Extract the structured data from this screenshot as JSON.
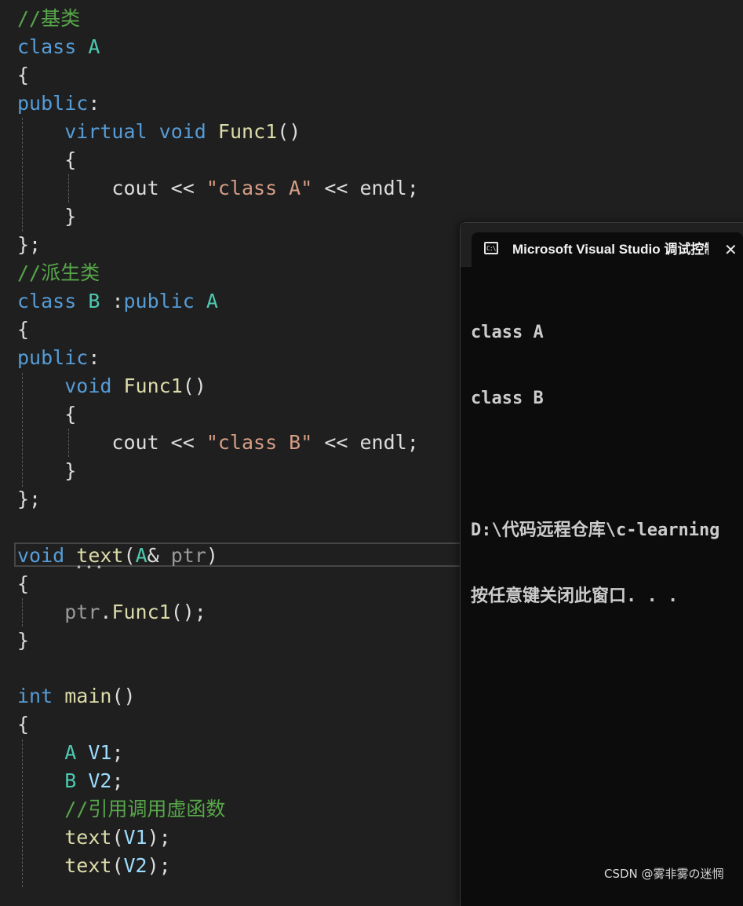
{
  "colors": {
    "background": "#1f1f1f",
    "comment": "#57a64a",
    "keyword": "#569cd6",
    "type": "#4ec9b0",
    "function": "#dcdcaa",
    "string": "#d69d85",
    "variable": "#9cdcfe",
    "param": "#9a9a9a",
    "text": "#dcdcdc",
    "console_bg": "#0c0c0c",
    "console_text": "#cccccc"
  },
  "editor": {
    "lines": [
      [
        [
          "comment",
          "//基类"
        ]
      ],
      [
        [
          "keyword",
          "class"
        ],
        [
          "text",
          " "
        ],
        [
          "type",
          "A"
        ]
      ],
      [
        [
          "text",
          "{"
        ]
      ],
      [
        [
          "keyword",
          "public"
        ],
        [
          "text",
          ":"
        ]
      ],
      [
        [
          "text",
          "    "
        ],
        [
          "keyword",
          "virtual"
        ],
        [
          "text",
          " "
        ],
        [
          "keyword",
          "void"
        ],
        [
          "text",
          " "
        ],
        [
          "function",
          "Func1"
        ],
        [
          "text",
          "()"
        ]
      ],
      [
        [
          "text",
          "    {"
        ]
      ],
      [
        [
          "text",
          "        cout << "
        ],
        [
          "string",
          "\"class A\""
        ],
        [
          "text",
          " << endl;"
        ]
      ],
      [
        [
          "text",
          "    }"
        ]
      ],
      [
        [
          "text",
          "};"
        ]
      ],
      [
        [
          "comment",
          "//派生类"
        ]
      ],
      [
        [
          "keyword",
          "class"
        ],
        [
          "text",
          " "
        ],
        [
          "type",
          "B"
        ],
        [
          "text",
          " :"
        ],
        [
          "keyword",
          "public"
        ],
        [
          "text",
          " "
        ],
        [
          "type",
          "A"
        ]
      ],
      [
        [
          "text",
          "{"
        ]
      ],
      [
        [
          "keyword",
          "public"
        ],
        [
          "text",
          ":"
        ]
      ],
      [
        [
          "text",
          "    "
        ],
        [
          "keyword",
          "void"
        ],
        [
          "text",
          " "
        ],
        [
          "function",
          "Func1"
        ],
        [
          "text",
          "()"
        ]
      ],
      [
        [
          "text",
          "    {"
        ]
      ],
      [
        [
          "text",
          "        cout << "
        ],
        [
          "string",
          "\"class B\""
        ],
        [
          "text",
          " << endl;"
        ]
      ],
      [
        [
          "text",
          "    }"
        ]
      ],
      [
        [
          "text",
          "};"
        ]
      ],
      [
        [
          "text",
          ""
        ]
      ],
      [
        [
          "keyword",
          "void"
        ],
        [
          "text",
          " "
        ],
        [
          "function",
          "text"
        ],
        [
          "text",
          "("
        ],
        [
          "type",
          "A"
        ],
        [
          "text",
          "& "
        ],
        [
          "param",
          "ptr"
        ],
        [
          "text",
          ")"
        ]
      ],
      [
        [
          "text",
          "{"
        ]
      ],
      [
        [
          "text",
          "    "
        ],
        [
          "param",
          "ptr"
        ],
        [
          "text",
          "."
        ],
        [
          "function",
          "Func1"
        ],
        [
          "text",
          "();"
        ]
      ],
      [
        [
          "text",
          "}"
        ]
      ],
      [
        [
          "text",
          ""
        ]
      ],
      [
        [
          "keyword",
          "int"
        ],
        [
          "text",
          " "
        ],
        [
          "function",
          "main"
        ],
        [
          "text",
          "()"
        ]
      ],
      [
        [
          "text",
          "{"
        ]
      ],
      [
        [
          "text",
          "    "
        ],
        [
          "type",
          "A"
        ],
        [
          "text",
          " "
        ],
        [
          "variable",
          "V1"
        ],
        [
          "text",
          ";"
        ]
      ],
      [
        [
          "text",
          "    "
        ],
        [
          "type",
          "B"
        ],
        [
          "text",
          " "
        ],
        [
          "variable",
          "V2"
        ],
        [
          "text",
          ";"
        ]
      ],
      [
        [
          "text",
          "    "
        ],
        [
          "comment",
          "//引用调用虚函数"
        ]
      ],
      [
        [
          "text",
          "    "
        ],
        [
          "function",
          "text"
        ],
        [
          "text",
          "("
        ],
        [
          "variable",
          "V1"
        ],
        [
          "text",
          ");"
        ]
      ],
      [
        [
          "text",
          "    "
        ],
        [
          "function",
          "text"
        ],
        [
          "text",
          "("
        ],
        [
          "variable",
          "V2"
        ],
        [
          "text",
          ");"
        ]
      ]
    ]
  },
  "console": {
    "icon": "terminal-icon",
    "icon_text": "C:\\",
    "title": "Microsoft Visual Studio 调试控制台",
    "close_icon": "close-icon",
    "close_symbol": "✕",
    "output": [
      "class A",
      "class B",
      "",
      "D:\\代码远程仓库\\c-learning",
      "按任意键关闭此窗口. . ."
    ]
  },
  "watermark": "CSDN @雾非雾の迷惘"
}
